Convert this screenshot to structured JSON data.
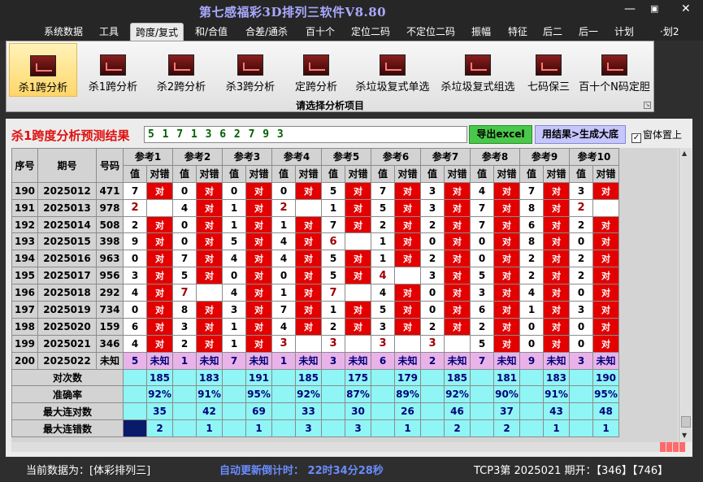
{
  "window": {
    "title": "第七感福彩3D排列三软件V8.80",
    "minimize": "—",
    "maximize": "▣",
    "close": "✕"
  },
  "menu": [
    "系统数据",
    "工具",
    "跨度/复式",
    "和/合值",
    "合差/通杀",
    "百十个",
    "定位二码",
    "不定位二码",
    "振幅",
    "特征",
    "后二",
    "后一",
    "计划",
    "·划2"
  ],
  "ribbon": {
    "buttons": [
      "杀1跨分析",
      "杀1跨分析",
      "杀2跨分析",
      "杀3跨分析",
      "定跨分析",
      "杀垃圾复式单选",
      "杀垃圾复式组选",
      "七码保三",
      "百十个N码定胆"
    ],
    "caption": "请选择分析项目"
  },
  "panel": {
    "title": "杀1跨度分析预测结果",
    "prediction": "5 1 7 1 3 6 2 7 9 3",
    "export_label": "导出excel",
    "generate_label": "用结果>生成大底",
    "ontop_label": "窗体置上",
    "ontop_checked": "✓"
  },
  "grid": {
    "col_seq": "序号",
    "col_period": "期号",
    "col_number": "号码",
    "groups": [
      "参考1",
      "参考2",
      "参考3",
      "参考4",
      "参考5",
      "参考6",
      "参考7",
      "参考8",
      "参考9",
      "参考10"
    ],
    "sub_value": "值",
    "sub_result": "对错",
    "rows": [
      {
        "seq": "190",
        "period": "2025012",
        "number": "471",
        "cells": [
          [
            "7",
            "对"
          ],
          [
            "0",
            "对"
          ],
          [
            "0",
            "对"
          ],
          [
            "0",
            "对"
          ],
          [
            "5",
            "对"
          ],
          [
            "7",
            "对"
          ],
          [
            "3",
            "对"
          ],
          [
            "4",
            "对"
          ],
          [
            "7",
            "对"
          ],
          [
            "3",
            "对"
          ]
        ]
      },
      {
        "seq": "191",
        "period": "2025013",
        "number": "978",
        "cells": [
          [
            "2",
            ""
          ],
          [
            "4",
            "对"
          ],
          [
            "1",
            "对"
          ],
          [
            "2",
            ""
          ],
          [
            "1",
            "对"
          ],
          [
            "5",
            "对"
          ],
          [
            "3",
            "对"
          ],
          [
            "7",
            "对"
          ],
          [
            "8",
            "对"
          ],
          [
            "2",
            ""
          ]
        ]
      },
      {
        "seq": "192",
        "period": "2025014",
        "number": "508",
        "cells": [
          [
            "2",
            "对"
          ],
          [
            "0",
            "对"
          ],
          [
            "1",
            "对"
          ],
          [
            "1",
            "对"
          ],
          [
            "7",
            "对"
          ],
          [
            "2",
            "对"
          ],
          [
            "2",
            "对"
          ],
          [
            "7",
            "对"
          ],
          [
            "6",
            "对"
          ],
          [
            "2",
            "对"
          ]
        ]
      },
      {
        "seq": "193",
        "period": "2025015",
        "number": "398",
        "cells": [
          [
            "9",
            "对"
          ],
          [
            "0",
            "对"
          ],
          [
            "5",
            "对"
          ],
          [
            "4",
            "对"
          ],
          [
            "6",
            ""
          ],
          [
            "1",
            "对"
          ],
          [
            "0",
            "对"
          ],
          [
            "0",
            "对"
          ],
          [
            "8",
            "对"
          ],
          [
            "0",
            "对"
          ]
        ]
      },
      {
        "seq": "194",
        "period": "2025016",
        "number": "963",
        "cells": [
          [
            "0",
            "对"
          ],
          [
            "7",
            "对"
          ],
          [
            "4",
            "对"
          ],
          [
            "4",
            "对"
          ],
          [
            "5",
            "对"
          ],
          [
            "1",
            "对"
          ],
          [
            "2",
            "对"
          ],
          [
            "0",
            "对"
          ],
          [
            "2",
            "对"
          ],
          [
            "2",
            "对"
          ]
        ]
      },
      {
        "seq": "195",
        "period": "2025017",
        "number": "956",
        "cells": [
          [
            "3",
            "对"
          ],
          [
            "5",
            "对"
          ],
          [
            "0",
            "对"
          ],
          [
            "0",
            "对"
          ],
          [
            "5",
            "对"
          ],
          [
            "4",
            ""
          ],
          [
            "3",
            "对"
          ],
          [
            "5",
            "对"
          ],
          [
            "2",
            "对"
          ],
          [
            "2",
            "对"
          ]
        ]
      },
      {
        "seq": "196",
        "period": "2025018",
        "number": "292",
        "cells": [
          [
            "4",
            "对"
          ],
          [
            "7",
            ""
          ],
          [
            "4",
            "对"
          ],
          [
            "1",
            "对"
          ],
          [
            "7",
            ""
          ],
          [
            "4",
            "对"
          ],
          [
            "0",
            "对"
          ],
          [
            "3",
            "对"
          ],
          [
            "4",
            "对"
          ],
          [
            "0",
            "对"
          ]
        ]
      },
      {
        "seq": "197",
        "period": "2025019",
        "number": "734",
        "cells": [
          [
            "0",
            "对"
          ],
          [
            "8",
            "对"
          ],
          [
            "3",
            "对"
          ],
          [
            "7",
            "对"
          ],
          [
            "1",
            "对"
          ],
          [
            "5",
            "对"
          ],
          [
            "0",
            "对"
          ],
          [
            "6",
            "对"
          ],
          [
            "1",
            "对"
          ],
          [
            "3",
            "对"
          ]
        ]
      },
      {
        "seq": "198",
        "period": "2025020",
        "number": "159",
        "cells": [
          [
            "6",
            "对"
          ],
          [
            "3",
            "对"
          ],
          [
            "1",
            "对"
          ],
          [
            "4",
            "对"
          ],
          [
            "2",
            "对"
          ],
          [
            "3",
            "对"
          ],
          [
            "2",
            "对"
          ],
          [
            "2",
            "对"
          ],
          [
            "0",
            "对"
          ],
          [
            "0",
            "对"
          ]
        ]
      },
      {
        "seq": "199",
        "period": "2025021",
        "number": "346",
        "cells": [
          [
            "4",
            "对"
          ],
          [
            "2",
            "对"
          ],
          [
            "1",
            "对"
          ],
          [
            "3",
            ""
          ],
          [
            "3",
            ""
          ],
          [
            "3",
            ""
          ],
          [
            "3",
            ""
          ],
          [
            "5",
            "对"
          ],
          [
            "0",
            "对"
          ],
          [
            "0",
            "对"
          ]
        ]
      },
      {
        "seq": "200",
        "period": "2025022",
        "number": "未知",
        "cells": [
          [
            "5",
            "未知"
          ],
          [
            "1",
            "未知"
          ],
          [
            "7",
            "未知"
          ],
          [
            "1",
            "未知"
          ],
          [
            "3",
            "未知"
          ],
          [
            "6",
            "未知"
          ],
          [
            "2",
            "未知"
          ],
          [
            "7",
            "未知"
          ],
          [
            "9",
            "未知"
          ],
          [
            "3",
            "未知"
          ]
        ]
      }
    ],
    "stats": [
      {
        "label": "对次数",
        "values": [
          "185",
          "183",
          "191",
          "185",
          "175",
          "179",
          "185",
          "181",
          "183",
          "190"
        ]
      },
      {
        "label": "准确率",
        "values": [
          "92%",
          "91%",
          "95%",
          "92%",
          "87%",
          "89%",
          "92%",
          "90%",
          "91%",
          "95%"
        ]
      },
      {
        "label": "最大连对数",
        "values": [
          "35",
          "42",
          "69",
          "33",
          "30",
          "26",
          "46",
          "37",
          "43",
          "48"
        ]
      },
      {
        "label": "最大连错数",
        "values": [
          "2",
          "1",
          "1",
          "3",
          "3",
          "1",
          "2",
          "2",
          "1",
          "1"
        ]
      }
    ]
  },
  "status": {
    "current_data": "当前数据为：[体彩排列三]",
    "countdown": "自动更新倒计时：  22时34分28秒",
    "draw_info": "TCP3第 2025021 期开：【346】【746】"
  },
  "colors": {
    "wrong_cell": "#e30000",
    "stat_cell": "#8ff5f5",
    "pending_row": "#e9b3e9",
    "title_text": "#a9a9ff"
  }
}
